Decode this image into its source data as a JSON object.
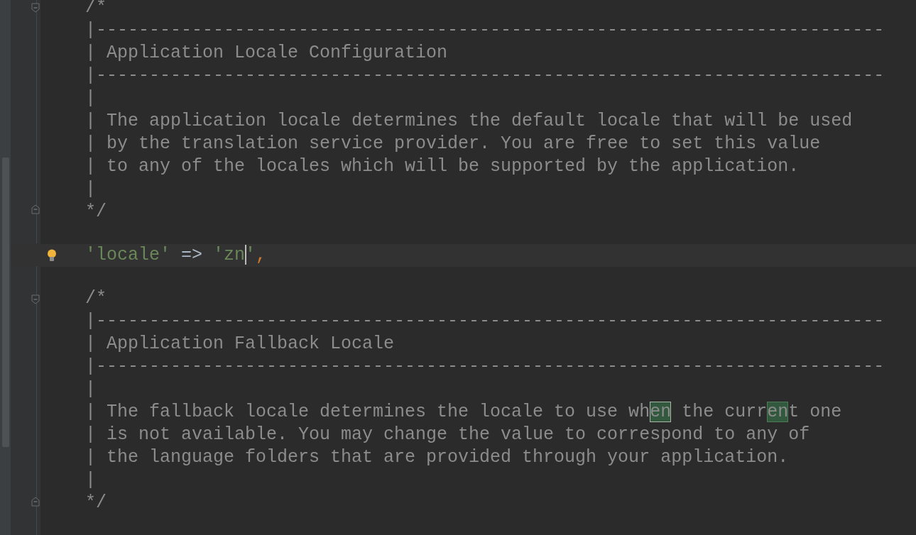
{
  "editor": {
    "lines": [
      {
        "kind": "comment",
        "fold_marker": {
          "kind": "start"
        },
        "segments": [
          {
            "text": "/*",
            "match": false
          }
        ]
      },
      {
        "kind": "comment",
        "segments": [
          {
            "text": "|--------------------------------------------------------------------------",
            "match": false
          }
        ]
      },
      {
        "kind": "comment",
        "segments": [
          {
            "text": "| Application Locale Configuration",
            "match": false
          }
        ]
      },
      {
        "kind": "comment",
        "segments": [
          {
            "text": "|--------------------------------------------------------------------------",
            "match": false
          }
        ]
      },
      {
        "kind": "comment",
        "segments": [
          {
            "text": "|",
            "match": false
          }
        ]
      },
      {
        "kind": "comment",
        "segments": [
          {
            "text": "| The application locale determines the default locale that will be used",
            "match": false
          }
        ]
      },
      {
        "kind": "comment",
        "segments": [
          {
            "text": "| by the translation service provider. You are free to set this value",
            "match": false
          }
        ]
      },
      {
        "kind": "comment",
        "segments": [
          {
            "text": "| to any of the locales which will be supported by the application.",
            "match": false
          }
        ]
      },
      {
        "kind": "comment",
        "segments": [
          {
            "text": "|",
            "match": false
          }
        ]
      },
      {
        "kind": "comment",
        "fold_marker": {
          "kind": "end"
        },
        "segments": [
          {
            "text": "*/",
            "match": false
          }
        ]
      },
      {
        "kind": "blank"
      },
      {
        "kind": "code",
        "current": true,
        "bulb": true,
        "tokens": [
          {
            "text": "'locale'",
            "kind": "string",
            "caret": false
          },
          {
            "text": " => ",
            "kind": "operator",
            "caret": false
          },
          {
            "text": "'zn",
            "kind": "string",
            "caret": true
          },
          {
            "text": "'",
            "kind": "string",
            "caret": false
          },
          {
            "text": ",",
            "kind": "punct",
            "caret": false
          }
        ]
      },
      {
        "kind": "blank"
      },
      {
        "kind": "comment",
        "fold_marker": {
          "kind": "start"
        },
        "segments": [
          {
            "text": "/*",
            "match": false
          }
        ]
      },
      {
        "kind": "comment",
        "segments": [
          {
            "text": "|--------------------------------------------------------------------------",
            "match": false
          }
        ]
      },
      {
        "kind": "comment",
        "segments": [
          {
            "text": "| Application Fallback Locale",
            "match": false
          }
        ]
      },
      {
        "kind": "comment",
        "segments": [
          {
            "text": "|--------------------------------------------------------------------------",
            "match": false
          }
        ]
      },
      {
        "kind": "comment",
        "segments": [
          {
            "text": "|",
            "match": false
          }
        ]
      },
      {
        "kind": "comment",
        "segments": [
          {
            "text": "| The fallback locale determines the locale to use wh",
            "match": false
          },
          {
            "text": "en",
            "match": true,
            "focused": true
          },
          {
            "text": " the curr",
            "match": false
          },
          {
            "text": "en",
            "match": true,
            "focused": false
          },
          {
            "text": "t one",
            "match": false
          }
        ]
      },
      {
        "kind": "comment",
        "segments": [
          {
            "text": "| is not available. You may change the value to correspond to any of",
            "match": false
          }
        ]
      },
      {
        "kind": "comment",
        "segments": [
          {
            "text": "| the language folders that are provided through your application.",
            "match": false
          }
        ]
      },
      {
        "kind": "comment",
        "segments": [
          {
            "text": "|",
            "match": false
          }
        ]
      },
      {
        "kind": "comment",
        "fold_marker": {
          "kind": "end"
        },
        "segments": [
          {
            "text": "*/",
            "match": false
          }
        ]
      },
      {
        "kind": "blank"
      }
    ]
  }
}
